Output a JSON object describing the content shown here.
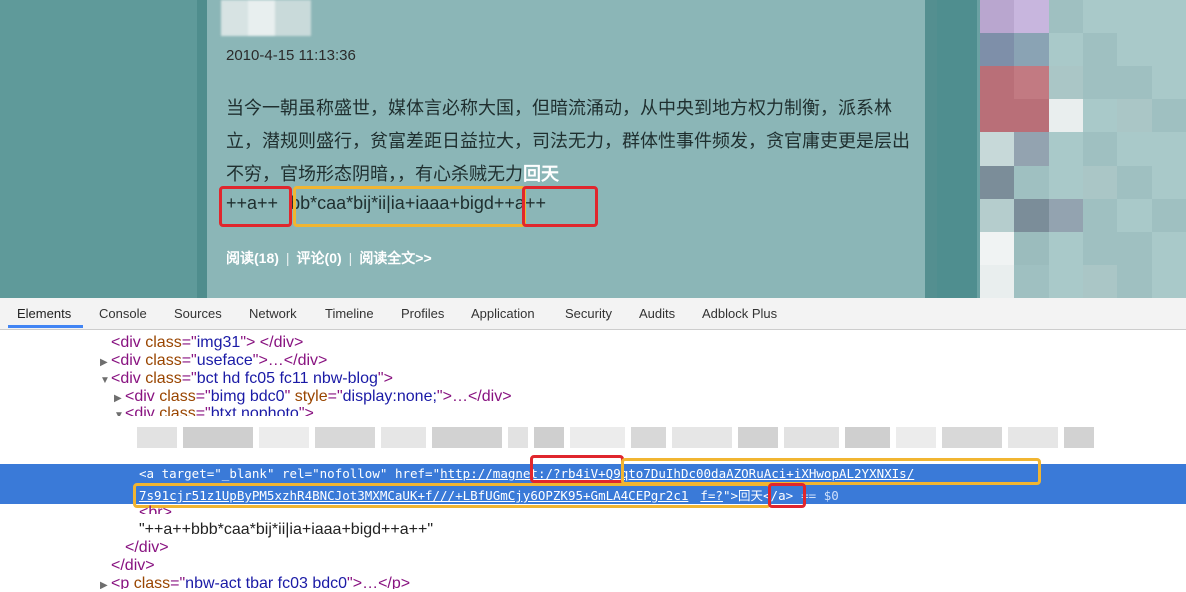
{
  "post": {
    "date": "2010-4-15 11:13:36",
    "body_text": "当今一朝虽称盛世，媒体言必称大国，但暗流涌动，从中央到地方权力制衡，派系林立，潜规则盛行，贫富差距日益拉大，司法无力，群体性事件频发，贪官庸吏更是层出不穷，官场形态阴暗，，有心杀贼无力",
    "body_highlight": "回天",
    "code_prefix": "++a++",
    "code_middle": "bb*caa*bij*ii|ia+iaaa+bigd",
    "code_suffix": "++a++",
    "actions": {
      "read": "阅读(18)",
      "comment": "评论(0)",
      "read_full": "阅读全文>>",
      "separator": "|"
    }
  },
  "devtools": {
    "tabs": [
      "Elements",
      "Console",
      "Sources",
      "Network",
      "Timeline",
      "Profiles",
      "Application",
      "Security",
      "Audits",
      "Adblock Plus"
    ],
    "active_tab": "Elements",
    "tree": {
      "l1": {
        "tag_open": "<div ",
        "attr": "class",
        "eq": "=\"",
        "val": "img31",
        "tail": "\"> </div>"
      },
      "l2": {
        "tag_open": "<div ",
        "attr": "class",
        "eq": "=\"",
        "val": "useface",
        "tail": "\">…</div>"
      },
      "l3": {
        "tag_open": "<div ",
        "attr": "class",
        "eq": "=\"",
        "val": "bct hd fc05 fc11 nbw-blog",
        "tail": "\">"
      },
      "l4": {
        "tag_open": "<div ",
        "attr": "class",
        "eq": "=\"",
        "val": "bimg bdc0",
        "attr2": "style",
        "val2": "display:none;",
        "tail": "\">…</div>"
      },
      "l5": {
        "tag_open": "<div ",
        "attr": "class",
        "eq": "=\"",
        "val": "btxt nophoto",
        "tail": "\">"
      },
      "anchor": {
        "tag_open": "<a ",
        "target_attr": "target",
        "target_val": "_blank",
        "rel_attr": "rel",
        "rel_val": "nofollow",
        "href_attr": "href",
        "href_part1": "http:/",
        "href_part2": "/magnet:/?",
        "href_part3": "rb4iV+Q9qto7DuIhDc00daAZORuAci+iXHwopAL2YXNXIs/",
        "href_part4": "7s91cjr51z1UpByPM5xzhR4BNCJot3MXMCaUK+f///+LBfUGmCjy6OPZK95+GmLA4CEPgr2c1",
        "href_part5": "f=?",
        "link_text": "回天",
        "close": "</a>",
        "eq_marker": "== $0"
      },
      "br": "<br>",
      "text_node": "\"++a++bbb*caa*bij*ii|ia+iaaa+bigd++a++\"",
      "close_div1": "</div>",
      "close_div2": "</div>",
      "last": {
        "tag_open": "<p ",
        "attr": "class",
        "eq": "=\"",
        "val": "nbw-act tbar fc03 bdc0",
        "tail": "\">…</p>"
      }
    }
  },
  "colors": {
    "highlight_red": "#e0262d",
    "highlight_orange": "#f1b531",
    "selection_blue": "#3a7ad8",
    "blog_bg": "#8bb6b7"
  }
}
